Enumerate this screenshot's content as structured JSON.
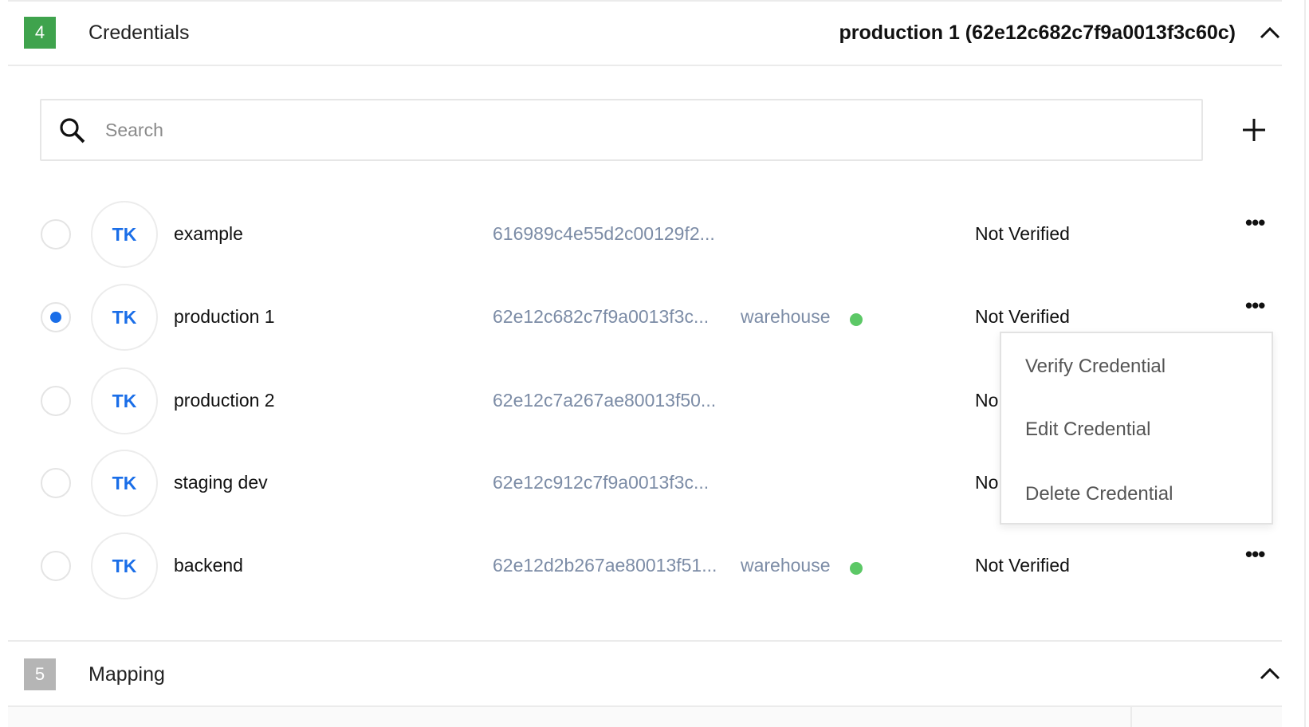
{
  "credentials_section": {
    "step": "4",
    "title": "Credentials",
    "selected_summary": "production 1 (62e12c682c7f9a0013f3c60c)",
    "badge_color": "#3fa34d"
  },
  "search": {
    "placeholder": "Search",
    "value": ""
  },
  "rows": [
    {
      "initials": "TK",
      "name": "example",
      "id": "616989c4e55d2c00129f2...",
      "tag": "",
      "status": "Not Verified",
      "selected": false
    },
    {
      "initials": "TK",
      "name": "production 1",
      "id": "62e12c682c7f9a0013f3c...",
      "tag": "warehouse",
      "status": "Not Verified",
      "selected": true
    },
    {
      "initials": "TK",
      "name": "production 2",
      "id": "62e12c7a267ae80013f50...",
      "tag": "",
      "status": "No",
      "selected": false
    },
    {
      "initials": "TK",
      "name": "staging dev",
      "id": "62e12c912c7f9a0013f3c...",
      "tag": "",
      "status": "No",
      "selected": false
    },
    {
      "initials": "TK",
      "name": "backend",
      "id": "62e12d2b267ae80013f51...",
      "tag": "warehouse",
      "status": "Not Verified",
      "selected": false
    }
  ],
  "context_menu": {
    "items": [
      "Verify Credential",
      "Edit Credential",
      "Delete Credential"
    ]
  },
  "mapping_section": {
    "step": "5",
    "title": "Mapping",
    "badge_color": "#b5b5b5"
  },
  "colors": {
    "accent": "#1a6ee8",
    "online": "#5cc866",
    "id_text": "#7c8ca6"
  }
}
